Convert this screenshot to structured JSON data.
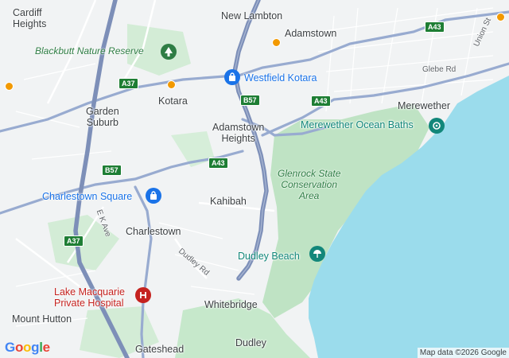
{
  "map": {
    "colors": {
      "water": "#9bdcec",
      "land": "#f1f3f4",
      "park": "#bfe3c4",
      "highway": "#7d8fb8",
      "primary_road": "#98abd0",
      "minor_road": "#ffffff",
      "pin_blue": "#1a73e8",
      "pin_teal": "#12877a",
      "pin_red": "#c5221f",
      "pin_green": "#2e7d44"
    },
    "places": {
      "cardiff_heights": "Cardiff\nHeights",
      "new_lambton": "New Lambton",
      "adamstown": "Adamstown",
      "kotara": "Kotara",
      "garden_suburb": "Garden\nSuburb",
      "adamstown_heights": "Adamstown\nHeights",
      "kahibah": "Kahibah",
      "charlestown": "Charlestown",
      "merewether": "Merewether",
      "whitebridge": "Whitebridge",
      "mount_hutton": "Mount Hutton",
      "gateshead": "Gateshead",
      "dudley": "Dudley"
    },
    "pois": {
      "blackbutt": "Blackbutt Nature Reserve",
      "westfield_kotara": "Westfield Kotara",
      "charlestown_square": "Charlestown Square",
      "merewether_baths": "Merewether Ocean Baths",
      "glenrock": "Glenrock State\nConservation\nArea",
      "dudley_beach": "Dudley Beach",
      "lake_macquarie_hospital": "Lake Macquarie\nPrivate Hospital"
    },
    "streets": {
      "glebe_rd": "Glebe Rd",
      "union_st": "Union St",
      "ek_ave": "E K Ave",
      "dudley_rd": "Dudley Rd"
    },
    "shields": {
      "a43_top": "A43",
      "a37_mid": "A37",
      "b57_mid": "B57",
      "a43_right": "A43",
      "a43_center": "A43",
      "b57_left": "B57",
      "a37_left": "A37"
    },
    "attribution": "Map data ©2026 Google",
    "logo": {
      "letters": [
        "G",
        "o",
        "o",
        "g",
        "l",
        "e"
      ],
      "colors": [
        "#4285f4",
        "#ea4335",
        "#fbbc05",
        "#4285f4",
        "#34a853",
        "#ea4335"
      ]
    }
  }
}
